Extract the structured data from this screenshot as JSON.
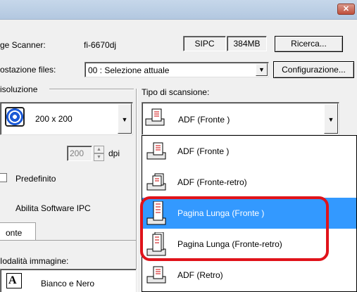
{
  "window": {
    "close_symbol": "✕"
  },
  "scanner": {
    "label": "ge Scanner:",
    "model": "fi-6670dj",
    "interface": "SIPC",
    "memory": "384MB",
    "search_button": "Ricerca..."
  },
  "settings_file": {
    "label": "ostazione files:",
    "value": "00 : Selezione attuale",
    "config_button": "Configurazione..."
  },
  "resolution": {
    "group_label": "isoluzione",
    "value": "200 x 200",
    "custom_value": "200",
    "unit": "dpi",
    "default_label": "Predefinito"
  },
  "scan_type": {
    "label": "Tipo di scansione:",
    "value": "ADF (Fronte )",
    "options": [
      {
        "label": "ADF (Fronte )",
        "selected": false
      },
      {
        "label": "ADF (Fronte-retro)",
        "selected": false
      },
      {
        "label": "Pagina Lunga (Fronte )",
        "selected": true
      },
      {
        "label": "Pagina Lunga (Fronte-retro)",
        "selected": false
      },
      {
        "label": "ADF (Retro)",
        "selected": false
      }
    ]
  },
  "ipc": {
    "label": "Abilita Software IPC"
  },
  "tabs": [
    {
      "label": "onte"
    }
  ],
  "image_mode": {
    "label": "Iodalità immagine:",
    "value": "Bianco e Nero",
    "icon_glyph": "A"
  },
  "more_button": "...",
  "paren": ")",
  "colors": {
    "highlight": "#3399ff",
    "callout": "#e0131a"
  }
}
